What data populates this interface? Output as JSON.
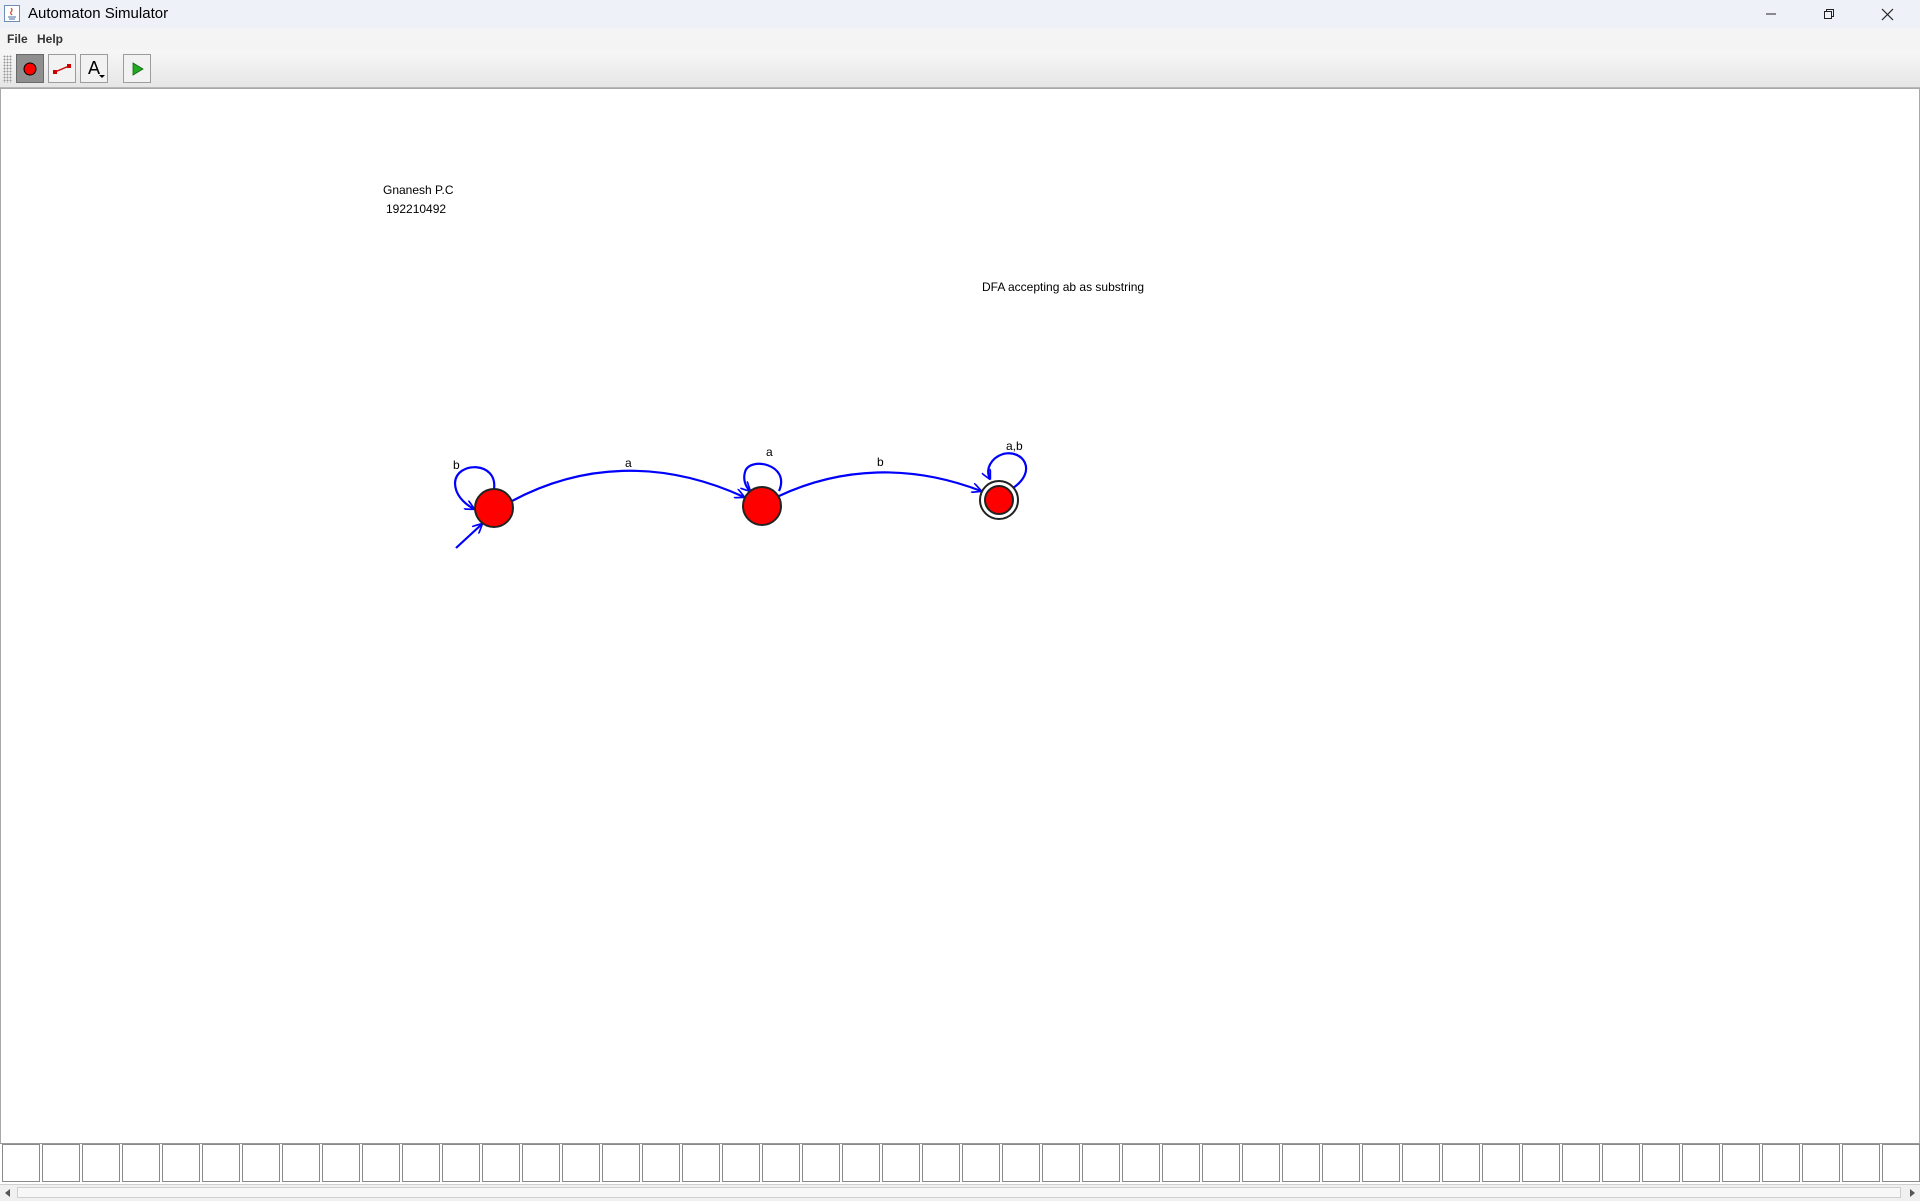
{
  "window": {
    "title": "Automaton Simulator",
    "controls": {
      "minimize_icon": "minimize-icon",
      "maximize_icon": "restore-icon",
      "close_icon": "close-icon"
    }
  },
  "menu": {
    "file": "File",
    "help": "Help"
  },
  "toolbar": {
    "tools": [
      {
        "icon": "state-tool-icon",
        "selected": true
      },
      {
        "icon": "transition-tool-icon",
        "selected": false
      },
      {
        "icon": "text-tool-icon",
        "selected": false
      },
      {
        "icon": "run-icon",
        "selected": false
      }
    ],
    "text_tool_glyph": "A"
  },
  "canvas": {
    "author_name": "Gnanesh P.C",
    "author_id": "192210492",
    "description": "DFA accepting ab as substring"
  },
  "automaton": {
    "states": [
      {
        "id": "q0",
        "initial": true,
        "accepting": false
      },
      {
        "id": "q1",
        "initial": false,
        "accepting": false
      },
      {
        "id": "q2",
        "initial": false,
        "accepting": true
      }
    ],
    "transitions": [
      {
        "from": "q0",
        "to": "q0",
        "label": "b"
      },
      {
        "from": "q0",
        "to": "q1",
        "label": "a"
      },
      {
        "from": "q1",
        "to": "q1",
        "label": "a"
      },
      {
        "from": "q1",
        "to": "q2",
        "label": "b"
      },
      {
        "from": "q2",
        "to": "q2",
        "label": "a,b"
      }
    ],
    "colors": {
      "state_fill": "#ff0000",
      "edge": "#0000ff"
    }
  },
  "tape": {
    "cells": 48
  }
}
